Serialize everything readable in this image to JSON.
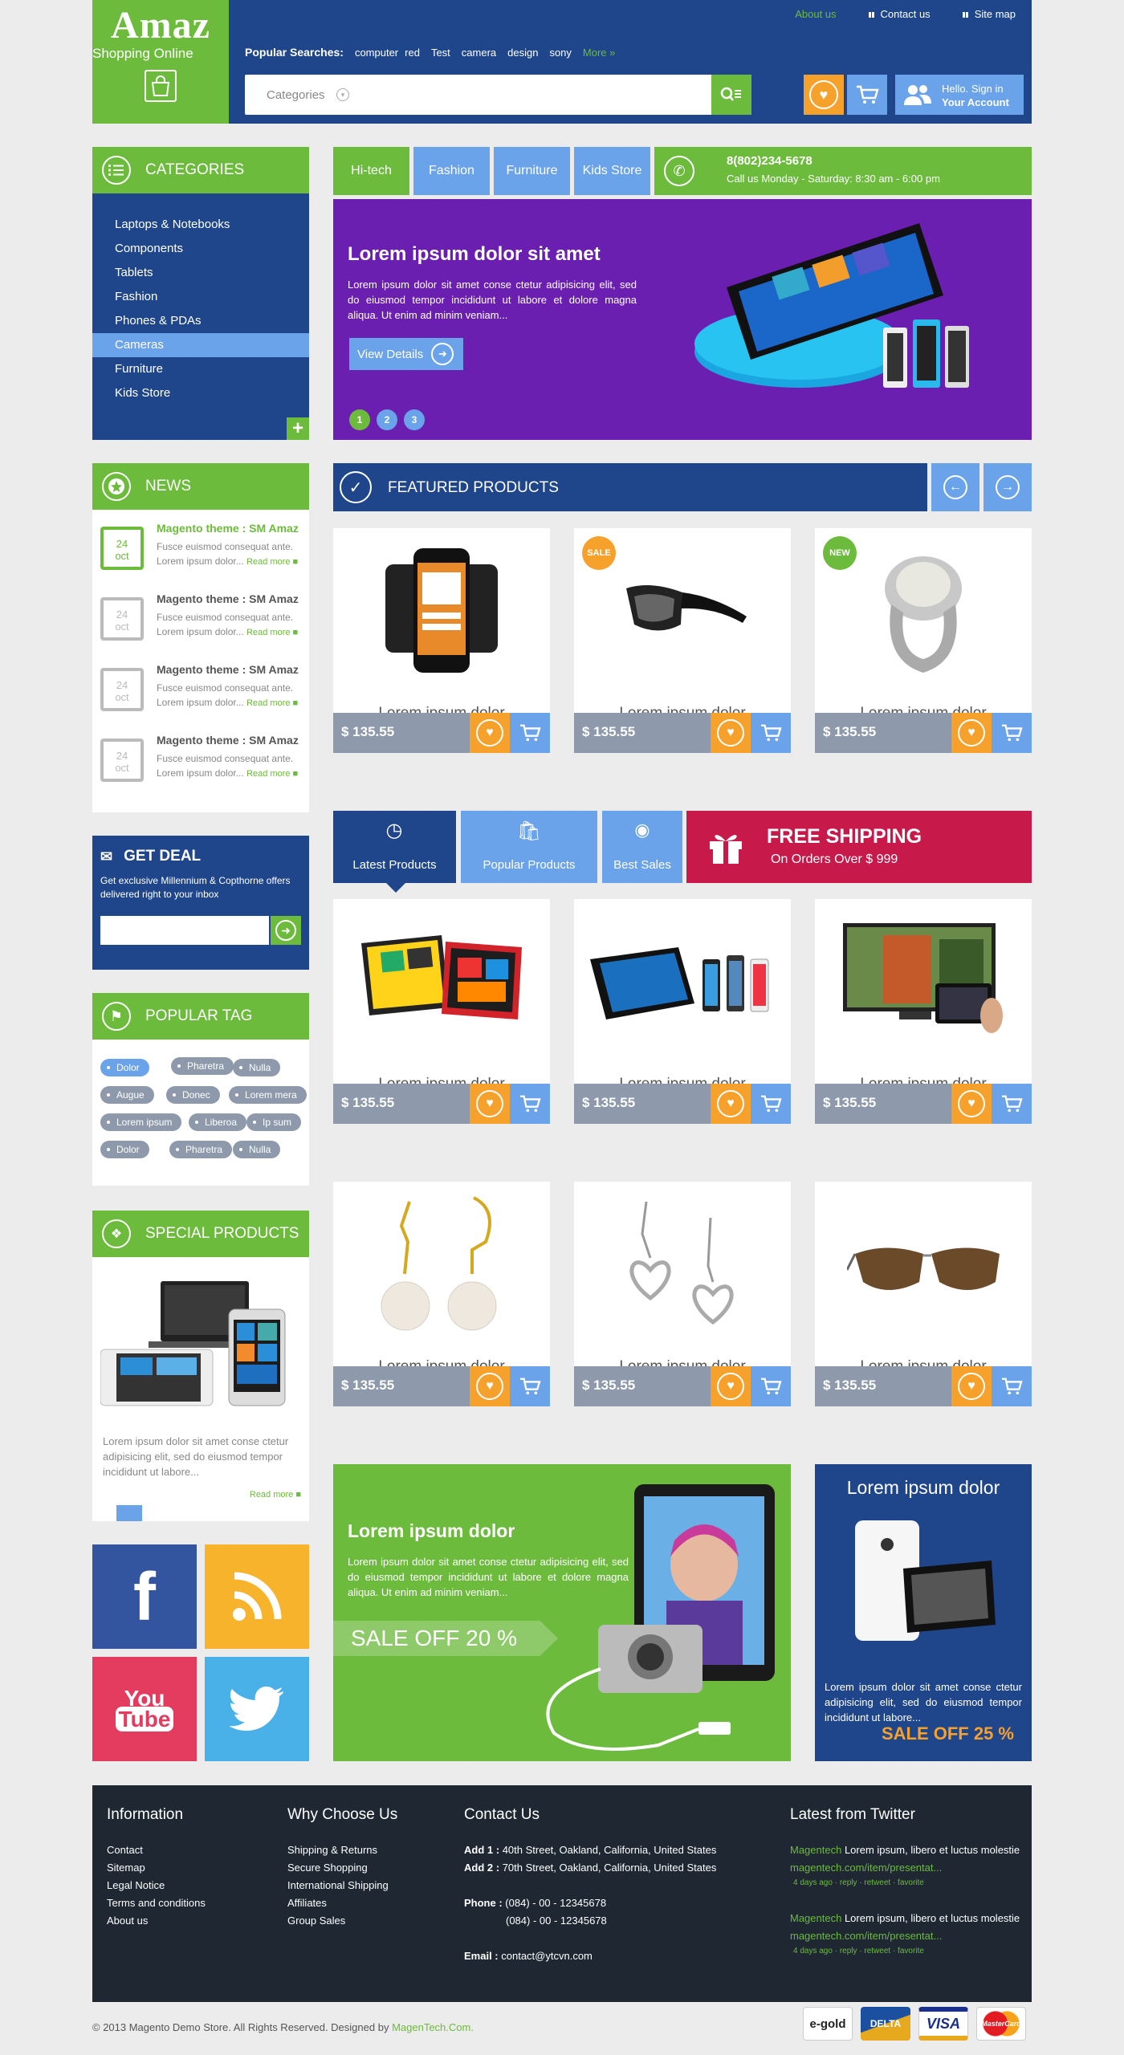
{
  "header": {
    "logo_title": "Amaz",
    "logo_tagline": "Shopping Online",
    "top_links": [
      "About us",
      "Contact us",
      "Site map"
    ],
    "popular_label": "Popular Searches:",
    "popular_terms": [
      "computer",
      "red",
      "Test",
      "camera",
      "design",
      "sony"
    ],
    "more_label": "More »",
    "search_category": "Categories",
    "search_value": "",
    "account_line1": "Hello. Sign in",
    "account_line2": "Your Account"
  },
  "categories": {
    "title": "CATEGORIES",
    "items": [
      "Laptops & Notebooks",
      "Components",
      "Tablets",
      "Fashion",
      "Phones & PDAs",
      "Cameras",
      "Furniture",
      "Kids Store"
    ],
    "active_index": 5
  },
  "nav": {
    "tabs": [
      "Hi-tech",
      "Fashion",
      "Furniture",
      "Kids Store"
    ],
    "phone": "8(802)234-5678",
    "hours": "Call us Monday - Saturday: 8:30 am - 6:00 pm"
  },
  "slider": {
    "title": "Lorem ipsum dolor sit amet",
    "text": "Lorem ipsum dolor sit amet conse ctetur adipisicing elit, sed do eiusmod tempor incididunt ut labore et dolore magna aliqua. Ut enim ad minim veniam...",
    "button": "View Details",
    "pages": [
      "1",
      "2",
      "3"
    ]
  },
  "news": {
    "title": "NEWS",
    "items": [
      {
        "day": "24",
        "month": "oct",
        "title": "Magento theme : SM Amaz",
        "text": "Fusce euismod consequat ante. Lorem ipsum dolor...",
        "more": "Read more"
      },
      {
        "day": "24",
        "month": "oct",
        "title": "Magento theme : SM Amaz",
        "text": "Fusce euismod consequat ante. Lorem ipsum dolor...",
        "more": "Read more"
      },
      {
        "day": "24",
        "month": "oct",
        "title": "Magento theme : SM Amaz",
        "text": "Fusce euismod consequat ante. Lorem ipsum dolor...",
        "more": "Read more"
      },
      {
        "day": "24",
        "month": "oct",
        "title": "Magento theme : SM Amaz",
        "text": "Fusce euismod consequat ante. Lorem ipsum dolor...",
        "more": "Read more"
      }
    ]
  },
  "deal": {
    "title": "GET DEAL",
    "text": "Get exclusive Millennium & Copthorne offers delivered right to your inbox",
    "email_value": ""
  },
  "tags": {
    "title": "POPULAR TAG",
    "items": [
      "Dolor",
      "Pharetra",
      "Nulla",
      "Augue",
      "Donec",
      "Lorem mera",
      "Lorem ipsum",
      "Liberoa",
      "Ip sum",
      "Dolor",
      "Pharetra",
      "Nulla"
    ]
  },
  "special": {
    "title": "SPECIAL PRODUCTS",
    "text": "Lorem ipsum dolor sit amet conse ctetur adipisicing elit, sed do eiusmod tempor incididunt ut labore...",
    "more": "Read more"
  },
  "featured": {
    "title": "FEATURED PRODUCTS",
    "products": [
      {
        "name": "Lorem ipsum dolor",
        "price": "$ 135.55",
        "badge": ""
      },
      {
        "name": "Lorem ipsum dolor",
        "price": "$ 135.55",
        "badge": "SALE"
      },
      {
        "name": "Lorem ipsum dolor",
        "price": "$ 135.55",
        "badge": "NEW"
      }
    ]
  },
  "tabs": {
    "items": [
      "Latest Products",
      "Popular Products",
      "Best Sales"
    ],
    "shipping_title": "FREE SHIPPING",
    "shipping_sub": "On Orders Over $ 999"
  },
  "latest": {
    "products": [
      {
        "name": "Lorem ipsum dolor",
        "price": "$ 135.55"
      },
      {
        "name": "Lorem ipsum dolor",
        "price": "$ 135.55"
      },
      {
        "name": "Lorem ipsum dolor",
        "price": "$ 135.55"
      },
      {
        "name": "Lorem ipsum dolor",
        "price": "$ 135.55"
      },
      {
        "name": "Lorem ipsum dolor",
        "price": "$ 135.55"
      },
      {
        "name": "Lorem ipsum dolor",
        "price": "$ 135.55"
      }
    ]
  },
  "promo1": {
    "title": "Lorem ipsum dolor",
    "text": "Lorem ipsum dolor sit amet conse ctetur adipisicing elit, sed do eiusmod tempor incididunt ut labore et dolore magna aliqua. Ut enim ad minim veniam...",
    "sale": "SALE OFF 20 %"
  },
  "promo2": {
    "title": "Lorem ipsum dolor",
    "text": "Lorem ipsum dolor sit amet conse ctetur adipisicing elit, sed do eiusmod tempor incididunt ut labore...",
    "sale": "SALE OFF 25 %"
  },
  "social": [
    "facebook",
    "rss",
    "youtube",
    "twitter"
  ],
  "footer": {
    "info_title": "Information",
    "info_links": [
      "Contact",
      "Sitemap",
      "Legal Notice",
      "Terms and conditions",
      "About us"
    ],
    "why_title": "Why Choose Us",
    "why_links": [
      "Shipping & Returns",
      "Secure Shopping",
      "International Shipping",
      "Affiliates",
      "Group Sales"
    ],
    "contact_title": "Contact Us",
    "add1_label": "Add 1 :",
    "add1": "40th Street, Oakland, California, United States",
    "add2_label": "Add 2 :",
    "add2": "70th Street, Oakland, California, United States",
    "phone_label": "Phone :",
    "phone1": "(084) - 00 - 12345678",
    "phone2": "(084) - 00 - 12345678",
    "email_label": "Email :",
    "email": "contact@ytcvn.com",
    "twitter_title": "Latest from Twitter",
    "tweets": [
      {
        "user": "Magentech",
        "text": "Lorem ipsum, libero et luctus molestie",
        "link": "magentech.com/item/presentat...",
        "meta": "4 days ago · reply · retweet · favorite"
      },
      {
        "user": "Magentech",
        "text": "Lorem ipsum, libero et luctus molestie",
        "link": "magentech.com/item/presentat...",
        "meta": "4 days ago · reply · retweet · favorite"
      }
    ],
    "copyright": "© 2013 Magento Demo Store. All Rights Reserved. Designed by",
    "designer": "MagenTech.Com.",
    "payments": [
      "e-gold",
      "DELTA",
      "VISA",
      "MasterCard"
    ]
  },
  "colors": {
    "green": "#6cbb3c",
    "navy": "#1f468b",
    "light_blue": "#6aa3ea",
    "orange": "#f7a12d",
    "purple": "#6a1fb0",
    "red": "#c8194b",
    "gray": "#8e9aab",
    "footer": "#1e2732"
  }
}
